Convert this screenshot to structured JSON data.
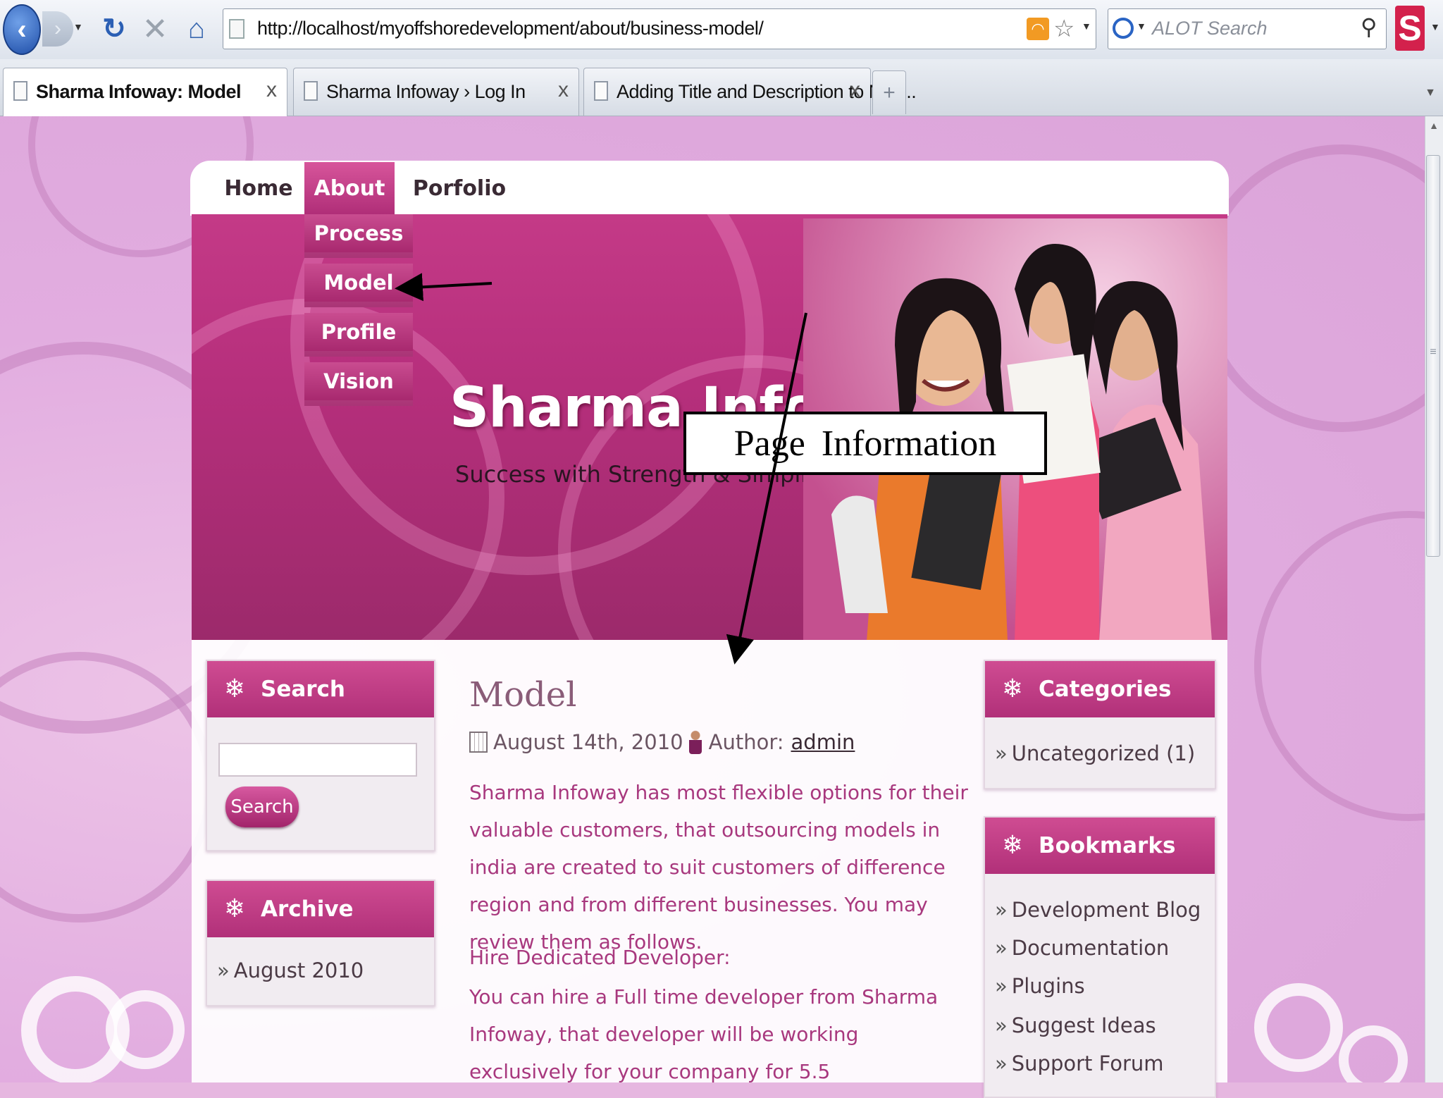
{
  "browser": {
    "url": "http://localhost/myoffshoredevelopment/about/business-model/",
    "search_placeholder": "ALOT Search",
    "tabs": [
      {
        "label": "Sharma Infoway: Model",
        "active": true
      },
      {
        "label": "Sharma Infoway › Log In",
        "active": false
      },
      {
        "label": "Adding Title and Description to Nex...",
        "active": false
      }
    ],
    "close_glyph": "x",
    "new_tab_glyph": "+",
    "addon_letter": "S"
  },
  "site": {
    "nav": {
      "home": "Home",
      "about": "About",
      "portfolio": "Porfolio"
    },
    "submenu": [
      "Process",
      "Model",
      "Profile",
      "Vision"
    ],
    "title": "Sharma Infoway",
    "tagline": "Success with Strength & Simplicity"
  },
  "callout": {
    "text": "Page  Information"
  },
  "sidebar_left": {
    "search": {
      "title": "Search",
      "button": "Search"
    },
    "archive": {
      "title": "Archive",
      "items": [
        "August 2010"
      ]
    }
  },
  "sidebar_right": {
    "categories": {
      "title": "Categories",
      "items": [
        "Uncategorized (1)"
      ]
    },
    "bookmarks": {
      "title": "Bookmarks",
      "items": [
        "Development Blog",
        "Documentation",
        "Plugins",
        "Suggest Ideas",
        "Support Forum"
      ]
    }
  },
  "post": {
    "title": "Model",
    "date": "August 14th, 2010",
    "author_label": "Author:",
    "author": "admin",
    "intro": "Sharma Infoway has most flexible options for their valuable customers, that outsourcing models in india are created to suit customers of difference region and from different businesses. You may review them as follows.",
    "subheading": "Hire Dedicated Developer:",
    "body": "You can hire a Full time developer from Sharma Infoway, that developer will be working exclusively for your company for 5.5"
  },
  "colors": {
    "accent": "#b62f7c",
    "page_bg": "#e2ade0",
    "post_text": "#a8387e"
  }
}
